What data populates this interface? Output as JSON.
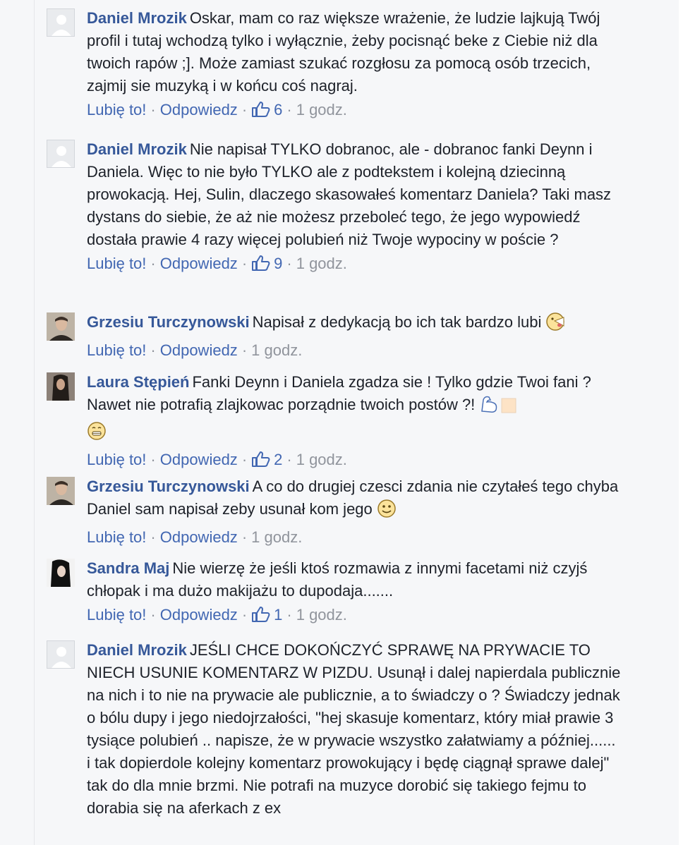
{
  "comments": [
    {
      "author": "Daniel Mrozik",
      "avatar": "default-avatar",
      "text": "Oskar, mam co raz większe wrażenie, że ludzie lajkują Twój profil i tutaj wchodzą tylko i wyłącznie, żeby pocisnąć beke z Ciebie niż dla twoich rapów ;]. Może zamiast szukać rozgłosu za pomocą osób trzecich, zajmij sie muzyką i w końcu coś nagraj.",
      "like_label": "Lubię to!",
      "reply_label": "Odpowiedz",
      "likes": "6",
      "time": "1 godz."
    },
    {
      "author": "Daniel Mrozik",
      "avatar": "default-avatar",
      "text": "Nie napisał TYLKO dobranoc, ale - dobranoc fanki Deynn i Daniela. Więc to nie było TYLKO ale z podtekstem i kolejną dziecinną prowokacją. Hej, Sulin, dlaczego skasowałeś komentarz Daniela? Taki masz dystans do siebie, że aż nie możesz przeboleć tego, że jego wypowiedź dostała prawie 4 razy więcej polubień niż Twoje wypociny w poście ?",
      "like_label": "Lubię to!",
      "reply_label": "Odpowiedz",
      "likes": "9",
      "time": "1 godz."
    },
    {
      "author": "Grzesiu Turczynowski",
      "avatar": "photo-avatar",
      "text": "Napisał z dedykacją bo ich tak bardzo lubi",
      "emoji": "tongue-emoji",
      "like_label": "Lubię to!",
      "reply_label": "Odpowiedz",
      "likes": "",
      "time": "1 godz."
    },
    {
      "author": "Laura Stępień",
      "avatar": "photo-avatar",
      "text": "Fanki Deynn i Daniela zgadza sie ! Tylko gdzie Twoi fani ? Nawet nie potrafią zlajkowac porządnie twoich postów ?!",
      "emoji": "muscle-grin-emoji",
      "like_label": "Lubię to!",
      "reply_label": "Odpowiedz",
      "likes": "2",
      "time": "1 godz."
    },
    {
      "author": "Grzesiu Turczynowski",
      "avatar": "photo-avatar",
      "text": "A co do drugiej czesci zdania nie czytałeś tego chyba Daniel sam napisał zeby usunał kom jego",
      "emoji": "smile-emoji",
      "like_label": "Lubię to!",
      "reply_label": "Odpowiedz",
      "likes": "",
      "time": "1 godz."
    },
    {
      "author": "Sandra Maj",
      "avatar": "photo-avatar",
      "text": "Nie wierzę że jeśli ktoś rozmawia z innymi facetami niż czyjś chłopak i ma dużo makijażu to dupodaja.......",
      "like_label": "Lubię to!",
      "reply_label": "Odpowiedz",
      "likes": "1",
      "time": "1 godz."
    },
    {
      "author": "Daniel Mrozik",
      "avatar": "default-avatar",
      "text": "JEŚLI CHCE DOKOŃCZYĆ SPRAWĘ NA PRYWACIE TO NIECH USUNIE KOMENTARZ W PIZDU. Usunął i dalej napierdala publicznie na nich i to nie na prywacie ale publicznie, a to świadczy o ? Świadczy jednak o bólu dupy i jego niedojrzałości, \"hej skasuje komentarz, który miał prawie 3 tysiące polubień .. napisze, że w prywacie wszystko załatwiamy a później...... i tak dopierdole kolejny komentarz prowokujący i będę ciągnął sprawe dalej\" tak do dla mnie brzmi. Nie potrafi na muzyce dorobić się takiego fejmu to dorabia się na aferkach z ex"
    }
  ],
  "separator": "·",
  "colors": {
    "author": "#365899",
    "link": "#4267b2",
    "meta": "#90949c",
    "text": "#1d2129",
    "background": "#f6f7f9"
  }
}
